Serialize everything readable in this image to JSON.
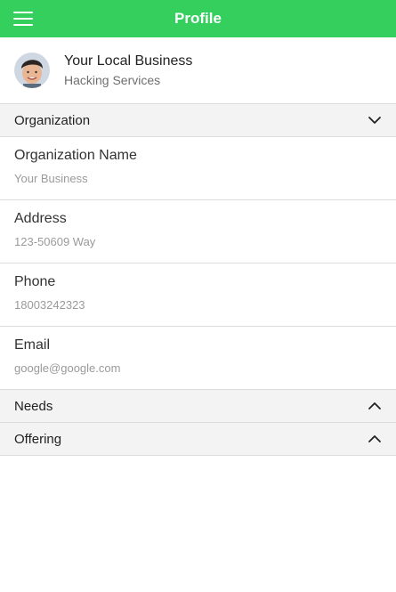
{
  "header": {
    "title": "Profile",
    "menu_icon": "menu-icon"
  },
  "profile": {
    "name": "Your Local Business",
    "subtitle": "Hacking Services"
  },
  "sections": {
    "organization": {
      "label": "Organization",
      "icon": "chevron-down-icon"
    },
    "needs": {
      "label": "Needs",
      "icon": "chevron-up-icon"
    },
    "offering": {
      "label": "Offering",
      "icon": "chevron-up-icon"
    }
  },
  "fields": [
    {
      "label": "Organization Name",
      "value": "Your Business"
    },
    {
      "label": "Address",
      "value": "123-50609 Way"
    },
    {
      "label": "Phone",
      "value": "18003242323"
    },
    {
      "label": "Email",
      "value": "google@google.com"
    }
  ],
  "colors": {
    "accent": "#35cf5e",
    "section_bg": "#f3f3f3",
    "divider": "#dcdcdc"
  }
}
